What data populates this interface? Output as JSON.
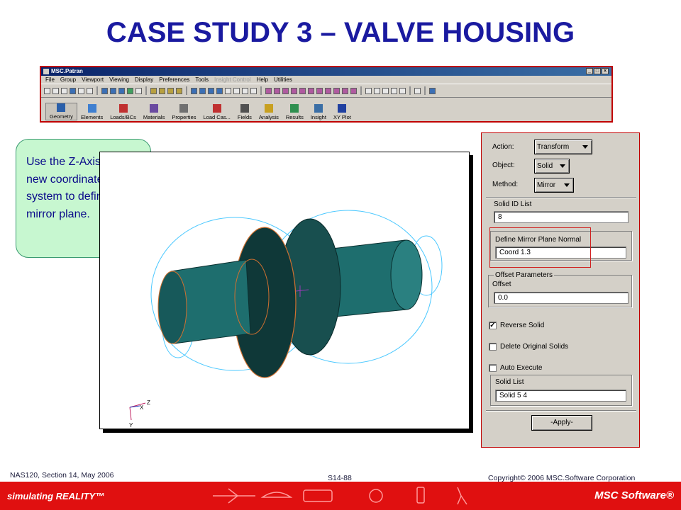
{
  "slide": {
    "title": "CASE STUDY 3 – VALVE HOUSING",
    "callout_text": "Use the Z-Axis of the new coordinate system to define the mirror plane.",
    "footer_left": "NAS120, Section 14, May 2006",
    "footer_center": "S14-88",
    "footer_right": "Copyright© 2006 MSC.Software Corporation",
    "bottom_tagline": "simulating REALITY™",
    "bottom_logo": "MSC Software®"
  },
  "patran": {
    "window_title": "MSC.Patran",
    "menu": [
      "File",
      "Group",
      "Viewport",
      "Viewing",
      "Display",
      "Preferences",
      "Tools",
      "Insight Control",
      "Help",
      "Utilities"
    ],
    "menu_disabled": [
      "Insight Control"
    ],
    "apps": [
      "Geometry",
      "Elements",
      "Loads/BCs",
      "Materials",
      "Properties",
      "Load Cas...",
      "Fields",
      "Analysis",
      "Results",
      "Insight",
      "XY Plot"
    ],
    "selected_app": "Geometry"
  },
  "viewport": {
    "triad_labels": {
      "z": "Z",
      "x": "X",
      "y": "Y"
    }
  },
  "form": {
    "action_label": "Action:",
    "action_value": "Transform",
    "object_label": "Object:",
    "object_value": "Solid",
    "method_label": "Method:",
    "method_value": "Mirror",
    "solid_id_list_label": "Solid ID List",
    "solid_id_list_value": "8",
    "mirror_plane_label": "Define Mirror Plane Normal",
    "mirror_plane_value": "Coord 1.3",
    "offset_group_label": "Offset Parameters",
    "offset_label": "Offset",
    "offset_value": "0.0",
    "reverse_solid_label": "Reverse Solid",
    "reverse_solid_checked": true,
    "delete_original_label": "Delete Original Solids",
    "delete_original_checked": false,
    "auto_execute_label": "Auto Execute",
    "auto_execute_checked": false,
    "solid_list_label": "Solid List",
    "solid_list_value": "Solid 5  4",
    "apply_label": "-Apply-"
  },
  "colors": {
    "title": "#1a1aa0",
    "callout_bg": "#c7f7d0",
    "solid_teal": "#1f6b6b",
    "highlight_red": "#c00000",
    "footer_red": "#e01010"
  }
}
